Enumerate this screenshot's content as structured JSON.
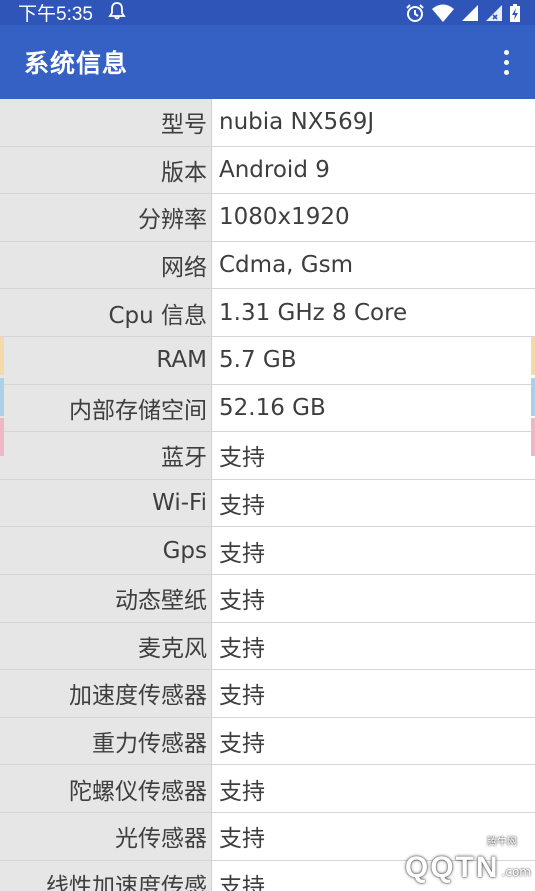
{
  "status_bar": {
    "time": "下午5:35",
    "icons": [
      "notification-bell-icon",
      "alarm-clock-icon",
      "wifi-icon",
      "signal-icon",
      "signal-no-data-icon",
      "battery-charging-icon"
    ]
  },
  "app_bar": {
    "title": "系统信息",
    "overflow_icon": "more-vert-icon"
  },
  "colors": {
    "status_bar": "#2f55b8",
    "app_bar": "#3560c4",
    "label_bg": "#e6e6e6",
    "text": "#3e3e3e"
  },
  "info_rows": [
    {
      "label": "型号",
      "value": "nubia NX569J"
    },
    {
      "label": "版本",
      "value": "Android 9"
    },
    {
      "label": "分辨率",
      "value": "1080x1920"
    },
    {
      "label": "网络",
      "value": "Cdma, Gsm"
    },
    {
      "label": "Cpu 信息",
      "value": "1.31 GHz 8 Core"
    },
    {
      "label": "RAM",
      "value": "5.7 GB"
    },
    {
      "label": "内部存储空间",
      "value": "52.16 GB"
    },
    {
      "label": "蓝牙",
      "value": "支持"
    },
    {
      "label": "Wi-Fi",
      "value": "支持"
    },
    {
      "label": "Gps",
      "value": "支持"
    },
    {
      "label": "动态壁纸",
      "value": "支持"
    },
    {
      "label": "麦克风",
      "value": "支持"
    },
    {
      "label": "加速度传感器",
      "value": "支持"
    },
    {
      "label": "重力传感器",
      "value": "支持"
    },
    {
      "label": "陀螺仪传感器",
      "value": "支持"
    },
    {
      "label": "光传感器",
      "value": "支持"
    },
    {
      "label": "线性加速度传感",
      "value": "支持"
    }
  ],
  "watermark": {
    "small": "腾牛网",
    "big": "QQTN",
    "suffix": ".com"
  }
}
